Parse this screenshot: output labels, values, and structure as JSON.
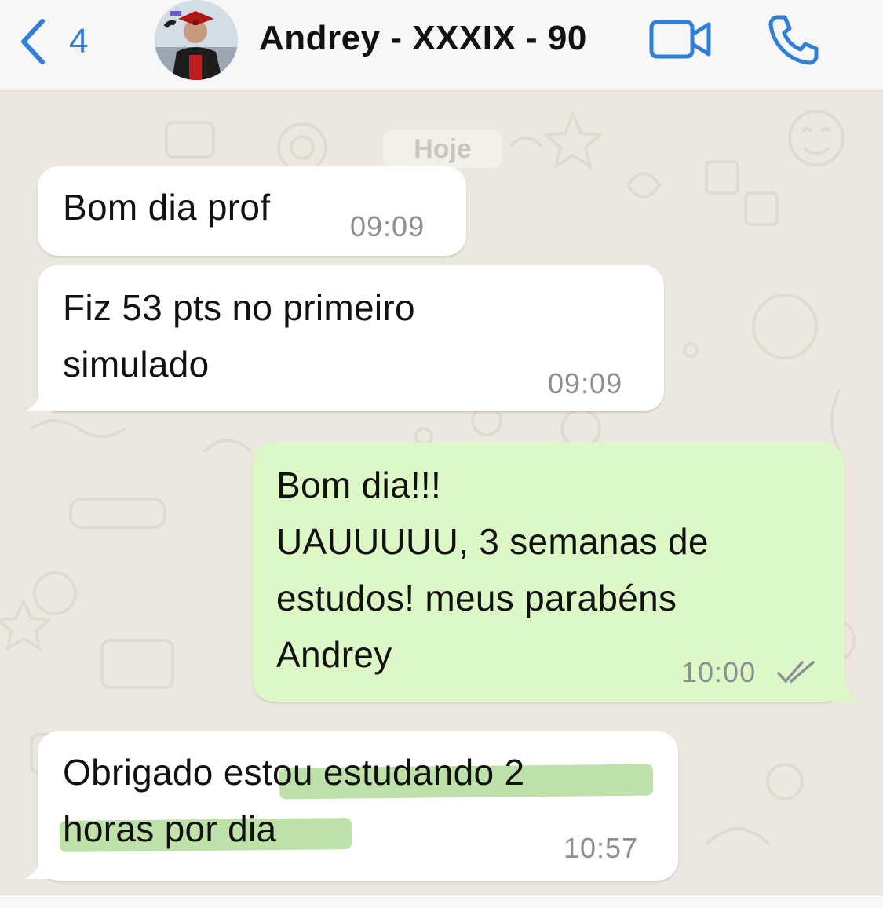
{
  "header": {
    "back_count": "4",
    "contact_name": "Andrey - XXXIX - 90",
    "icons": {
      "back": "chevron-left-icon",
      "video": "video-camera-icon",
      "call": "phone-icon"
    },
    "accent_color": "#2f7ed8"
  },
  "chat": {
    "date_label": "Hoje",
    "messages": [
      {
        "direction": "incoming",
        "text": "Bom dia prof",
        "time": "09:09"
      },
      {
        "direction": "incoming",
        "text": "Fiz 53 pts no primeiro\nsimulado",
        "time": "09:09"
      },
      {
        "direction": "outgoing",
        "text": "Bom dia!!!\nUAUUUUU, 3 semanas de\nestudos! meus parabéns\nAndrey",
        "time": "10:00",
        "status": "read-ticks-icon"
      },
      {
        "direction": "incoming",
        "text": "Obrigado estou estudando 2\nhoras por dia",
        "time": "10:57",
        "highlighted": true
      }
    ],
    "colors": {
      "incoming_bubble": "#ffffff",
      "outgoing_bubble": "#dcf8c6",
      "wallpaper": "#ece8df",
      "highlight": "#a8d68c"
    }
  }
}
